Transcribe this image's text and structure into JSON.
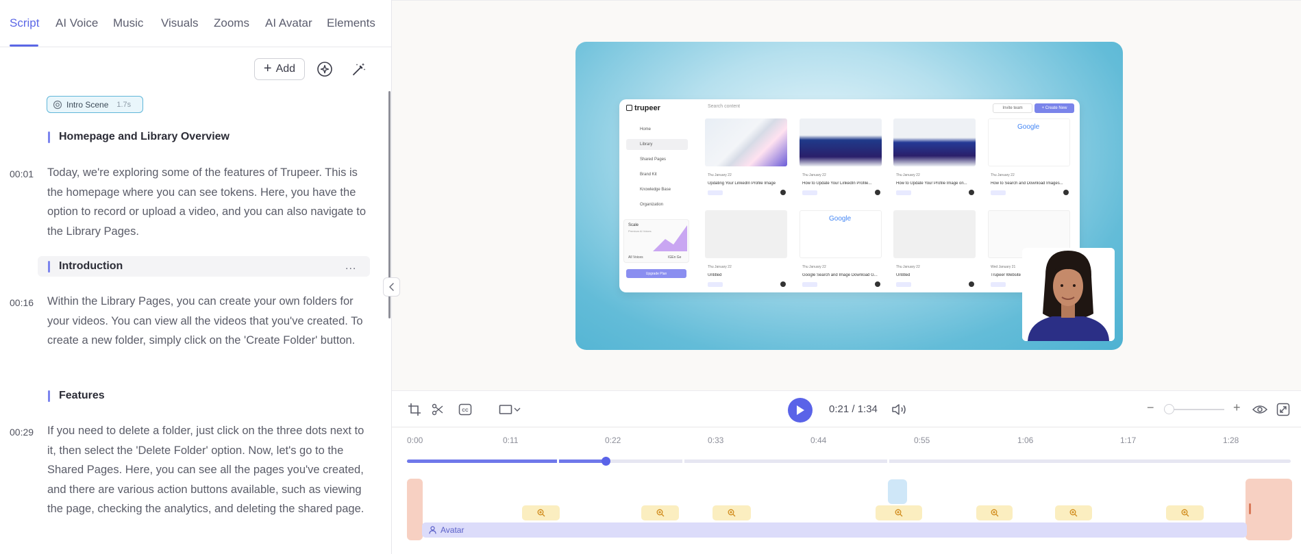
{
  "tabs": [
    {
      "label": "Script",
      "active": true
    },
    {
      "label": "AI Voice"
    },
    {
      "label": "Music"
    },
    {
      "label": "Visuals"
    },
    {
      "label": "Zooms"
    },
    {
      "label": "AI Avatar"
    },
    {
      "label": "Elements"
    }
  ],
  "toolbar": {
    "add_label": "Add"
  },
  "intro_scene": {
    "label": "Intro Scene",
    "duration": "1.7s"
  },
  "script": [
    {
      "heading": "Homepage and Library Overview",
      "timestamp": "00:01",
      "text": "Today, we're exploring some of the features of Trupeer. This is the homepage where you can see tokens. Here, you have the option to record or upload a video, and you can also navigate to the Library Pages."
    },
    {
      "heading": "Introduction",
      "menu": "...",
      "timestamp": "00:16",
      "text": "Within the Library Pages, you can create your own folders for your videos. You can view all the videos that you've created. To create a new folder, simply click on the 'Create Folder' button."
    },
    {
      "heading": "Features",
      "timestamp": "00:29",
      "text": "If you need to delete a folder, just click on the three dots next to it, then select the 'Delete Folder' option. Now, let's go to the Shared Pages. Here, you can see all the pages you've created, and there are various action buttons available, such as viewing the page, checking the analytics, and deleting the shared page."
    }
  ],
  "preview": {
    "logo": "trupeer",
    "search_placeholder": "Search content",
    "btn_invite": "Invite team",
    "btn_create": "+ Create New",
    "nav": [
      "Home",
      "Library",
      "Shared Pages",
      "Brand Kit",
      "Knowledge Base",
      "Organization"
    ],
    "promo_title": "Scale",
    "promo_sub": "Premium AI Voices",
    "promo_left": "All Voices",
    "promo_right": "IGEn Ge",
    "upgrade": "Upgrade Plan",
    "cards": [
      {
        "date": "Thu January 22",
        "title": "Updating Your LinkedIn Profile Image"
      },
      {
        "date": "Thu January 22",
        "title": "How to Update Your LinkedIn Profile..."
      },
      {
        "date": "Thu January 22",
        "title": "How to Update Your Profile Image on..."
      },
      {
        "date": "Thu January 22",
        "title": "How to Search and Download Images..."
      },
      {
        "date": "Thu January 22",
        "title": "Untitled"
      },
      {
        "date": "Thu January 22",
        "title": "Google Search and Image Download G..."
      },
      {
        "date": "Thu January 22",
        "title": "Untitled"
      },
      {
        "date": "Wed January 21",
        "title": "Trupeer Website"
      }
    ],
    "google_text": "Google"
  },
  "player": {
    "timecode": "0:21 / 1:34"
  },
  "timeline": {
    "ticks": [
      "0:00",
      "0:11",
      "0:22",
      "0:33",
      "0:44",
      "0:55",
      "1:06",
      "1:17",
      "1:28"
    ],
    "progress_fraction": 0.22,
    "avatar_label": "Avatar"
  },
  "colors": {
    "accent": "#5a63e8",
    "avatar_track": "#dcdcfa",
    "zoom_chip": "#fbeec0",
    "clip": "#f7d0c2"
  }
}
